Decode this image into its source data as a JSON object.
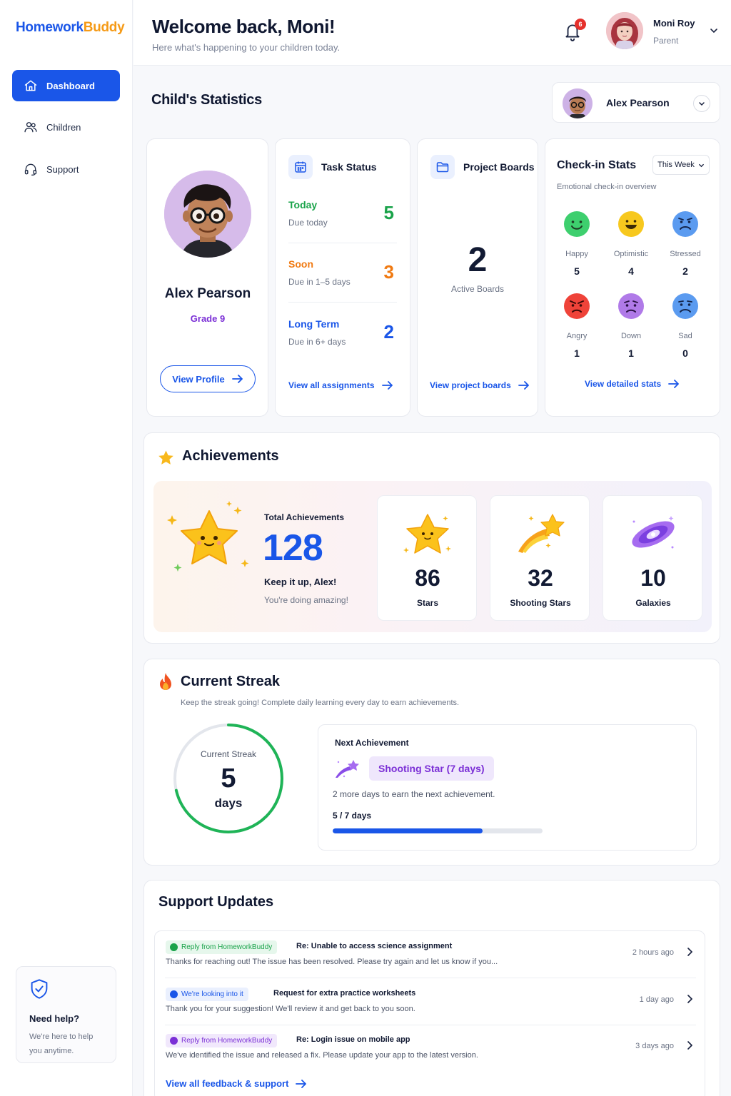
{
  "brand": {
    "part1": "Homework",
    "part2": "Buddy"
  },
  "sidebar": {
    "items": [
      {
        "label": "Dashboard",
        "icon": "home-icon"
      },
      {
        "label": "Children",
        "icon": "users-icon"
      },
      {
        "label": "Support",
        "icon": "headset-icon"
      }
    ],
    "help": {
      "title": "Need help?",
      "text": "We're here to help you anytime.",
      "icon": "shield-check-icon"
    }
  },
  "header": {
    "welcome": "Welcome back, Moni!",
    "subtitle": "Here what's happening to your children today.",
    "notifications": "6",
    "user_name": "Moni Roy",
    "user_role": "Parent"
  },
  "stats": {
    "title": "Child's Statistics",
    "selected_child": "Alex Pearson"
  },
  "profile": {
    "name": "Alex Pearson",
    "grade": "Grade 9",
    "button": "View Profile"
  },
  "tasks": {
    "title": "Task Status",
    "rows": [
      {
        "label": "Today",
        "due": "Due today",
        "count": "5",
        "color": "#1aa34a"
      },
      {
        "label": "Soon",
        "due": "Due in 1–5 days",
        "count": "3",
        "color": "#f07a12"
      },
      {
        "label": "Long Term",
        "due": "Due in 6+ days",
        "count": "2",
        "color": "#1a56e8"
      }
    ],
    "link": "View all assignments"
  },
  "boards": {
    "title": "Project Boards",
    "count": "2",
    "label": "Active Boards",
    "link": "View project boards"
  },
  "checkin": {
    "title": "Check-in Stats",
    "period": "This Week",
    "subtitle": "Emotional check-in overview",
    "emotions": [
      {
        "name": "Happy",
        "count": "5",
        "color": "#3ecf6e"
      },
      {
        "name": "Optimistic",
        "count": "4",
        "color": "#f7c81e"
      },
      {
        "name": "Stressed",
        "count": "2",
        "color": "#5b9bf0"
      },
      {
        "name": "Angry",
        "count": "1",
        "color": "#ef4339"
      },
      {
        "name": "Down",
        "count": "1",
        "color": "#b07ae8"
      },
      {
        "name": "Sad",
        "count": "0",
        "color": "#5b9bf0"
      }
    ],
    "link": "View detailed stats"
  },
  "achievements": {
    "title": "Achievements",
    "total_label": "Total Achievements",
    "total": "128",
    "keep": "Keep it up, Alex!",
    "doing": "You're doing amazing!",
    "tiles": [
      {
        "value": "86",
        "label": "Stars"
      },
      {
        "value": "32",
        "label": "Shooting Stars"
      },
      {
        "value": "10",
        "label": "Galaxies"
      }
    ]
  },
  "streak": {
    "title": "Current Streak",
    "subtitle": "Keep the streak going! Complete daily learning every day to earn achievements.",
    "ring_label": "Current Streak",
    "days": "5",
    "days_unit": "days",
    "progress": 0.714,
    "next_title": "Next Achievement",
    "next_badge": "Shooting Star (7 days)",
    "next_more": "2 more days to earn the next achievement.",
    "next_progress": "5 / 7 days"
  },
  "support": {
    "title": "Support Updates",
    "items": [
      {
        "tag": "Reply from HomeworkBuddy",
        "tag_bg": "#e6f7ec",
        "tag_color": "#1aa34a",
        "subject": "Re: Unable to access science assignment",
        "message": "Thanks for reaching out! The issue has been resolved. Please try again  and let us know if you...",
        "time": "2 hours ago"
      },
      {
        "tag": "We're looking into it",
        "tag_bg": "#eaf0fe",
        "tag_color": "#1a56e8",
        "subject": "Request for extra practice worksheets",
        "message": "Thank you for your suggestion! We'll review it and get back to you soon.",
        "time": "1 day ago"
      },
      {
        "tag": "Reply from HomeworkBuddy",
        "tag_bg": "#f1e8fc",
        "tag_color": "#7b2fd6",
        "subject": "Re: Login issue on mobile app",
        "message": "We've identified the issue and released a fix. Please update your app to the latest version.",
        "time": "3 days ago"
      }
    ],
    "link": "View all feedback & support"
  }
}
